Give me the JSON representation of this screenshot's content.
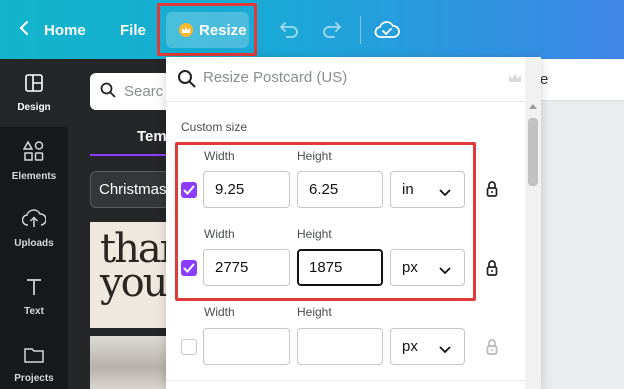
{
  "topbar": {
    "home_label": "Home",
    "file_label": "File",
    "resize_label": "Resize",
    "colors": {
      "accent_start": "#12b5cb",
      "accent_end": "#3f86e8",
      "highlight": "#e03a3a"
    }
  },
  "rail": {
    "items": [
      {
        "label": "Design",
        "icon": "layout-icon"
      },
      {
        "label": "Elements",
        "icon": "shapes-icon"
      },
      {
        "label": "Uploads",
        "icon": "cloud-upload-icon"
      },
      {
        "label": "Text",
        "icon": "text-icon"
      },
      {
        "label": "Projects",
        "icon": "folder-icon"
      }
    ]
  },
  "panel": {
    "search_placeholder": "Searc",
    "tab_label": "Temp",
    "chip_label": "Christmas",
    "thumb_text_line1": "than",
    "thumb_text_line2": "you."
  },
  "canvas": {
    "partial_label": "e"
  },
  "resize": {
    "search_placeholder": "Resize Postcard (US)",
    "section_title": "Custom size",
    "rows": [
      {
        "width_label": "Width",
        "height_label": "Height",
        "width": "9.25",
        "height": "6.25",
        "unit": "in",
        "checked": true
      },
      {
        "width_label": "Width",
        "height_label": "Height",
        "width": "2775",
        "height": "1875",
        "unit": "px",
        "checked": true
      },
      {
        "width_label": "Width",
        "height_label": "Height",
        "width": "",
        "height": "",
        "unit": "px",
        "checked": false
      }
    ]
  }
}
